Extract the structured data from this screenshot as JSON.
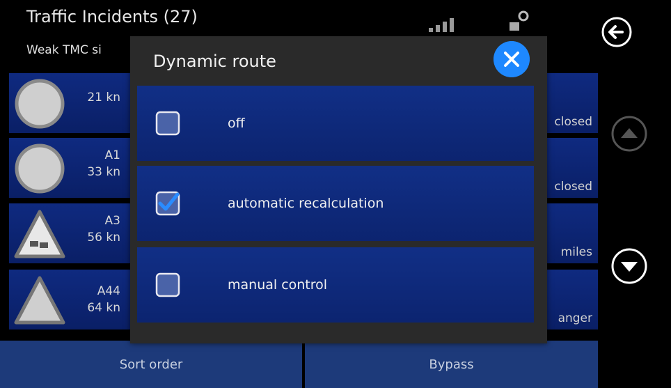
{
  "header": {
    "title": "Traffic Incidents (27)",
    "subtitle": "Weak TMC si"
  },
  "incidents": [
    {
      "distance": "21 kn",
      "road": "",
      "status": "closed",
      "icon": "generic-circle-icon"
    },
    {
      "road": "A1",
      "distance": "33 kn",
      "status": "closed",
      "icon": "generic-circle-icon"
    },
    {
      "road": "A3",
      "distance": "56 kn",
      "status": "miles",
      "icon": "traffic-jam-warning-icon"
    },
    {
      "road": "A44",
      "distance": "64 kn",
      "status": "anger",
      "icon": "warning-triangle-icon"
    }
  ],
  "bottom": {
    "sort_label": "Sort order",
    "bypass_label": "Bypass"
  },
  "dialog": {
    "title": "Dynamic route",
    "options": [
      {
        "label": "off",
        "checked": false
      },
      {
        "label": "automatic recalculation",
        "checked": true
      },
      {
        "label": "manual control",
        "checked": false
      }
    ]
  },
  "colors": {
    "accent": "#1e88ff",
    "row_blue": "#0f2a80",
    "dialog_bg": "#2a2a2a",
    "button_bg": "#1d3a7a"
  }
}
